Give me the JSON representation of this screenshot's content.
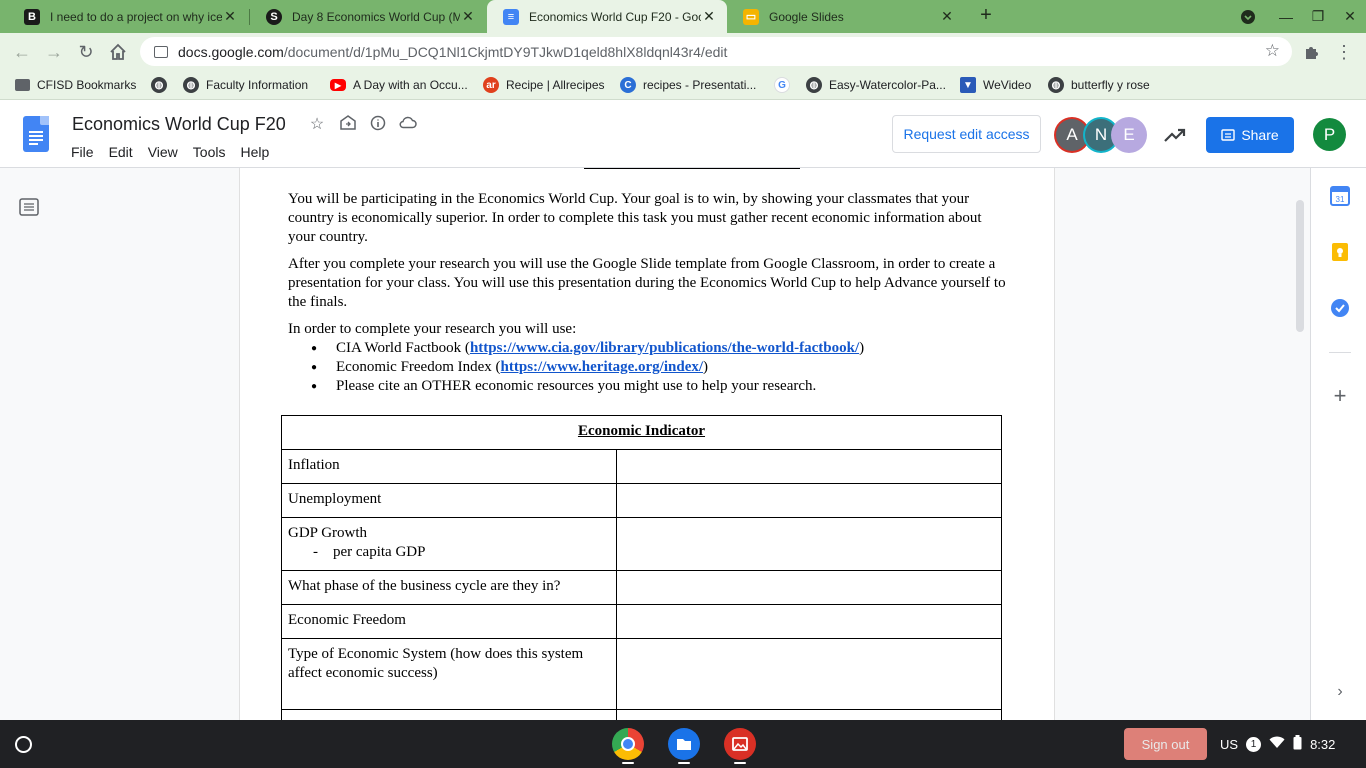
{
  "browser": {
    "tabs": [
      {
        "title": "I need to do a project on why ice",
        "favicon": "brainly-icon",
        "active": false
      },
      {
        "title": "Day 8 Economics World Cup (M",
        "favicon": "schoology-icon",
        "active": false
      },
      {
        "title": "Economics World Cup F20 - Goo",
        "favicon": "google-docs-icon",
        "active": true
      },
      {
        "title": "Google Slides",
        "favicon": "google-slides-icon",
        "active": false
      }
    ],
    "url_domain": "docs.google.com",
    "url_path": "/document/d/1pMu_DCQ1Nl1CkjmtDY9TJkwD1qeld8hlX8ldqnl43r4/edit",
    "bookmarks": [
      {
        "label": "CFISD Bookmarks",
        "icon": "folder-icon"
      },
      {
        "label": "",
        "icon": "globe-icon"
      },
      {
        "label": "Faculty Information",
        "icon": "globe-icon"
      },
      {
        "label": "A Day with an Occu...",
        "icon": "youtube-icon"
      },
      {
        "label": "Recipe | Allrecipes",
        "icon": "allrecipes-icon"
      },
      {
        "label": "recipes - Presentati...",
        "icon": "canva-icon"
      },
      {
        "label": "",
        "icon": "google-icon"
      },
      {
        "label": "Easy-Watercolor-Pa...",
        "icon": "globe-icon"
      },
      {
        "label": "WeVideo",
        "icon": "wevideo-icon"
      },
      {
        "label": "butterfly y rose",
        "icon": "globe-icon"
      }
    ]
  },
  "docs": {
    "title": "Economics World Cup F20",
    "menu": [
      "File",
      "Edit",
      "View",
      "Tools",
      "Help"
    ],
    "request_edit_label": "Request edit access",
    "share_label": "Share",
    "collaborators": [
      {
        "initial": "A",
        "color": "#5f6368",
        "ring": "#d93025"
      },
      {
        "initial": "N",
        "color": "#3c6f7a",
        "ring": "#12b5cb"
      },
      {
        "initial": "E",
        "color": "#b7a9e0",
        "ring": "#b7a9e0"
      }
    ],
    "profile_initial": "P"
  },
  "document": {
    "para1": "You will be participating in the Economics World Cup. Your goal is to win, by showing your classmates that your country is economically superior. In order to complete this task you must gather recent economic information about your country.",
    "para2": "After you complete your research you will use the Google Slide template from Google Classroom, in order to create a presentation for your class. You will use this presentation during the Economics World Cup to help Advance yourself to the finals.",
    "para3": "In order to complete your research you will use:",
    "bullets": [
      {
        "prefix": "CIA World Factbook (",
        "link": "https://www.cia.gov/library/publications/the-world-factbook/",
        "suffix": ")"
      },
      {
        "prefix": "Economic Freedom Index (",
        "link": "https://www.heritage.org/index/",
        "suffix": ")"
      },
      {
        "prefix": "Please cite an OTHER economic resources you might use to help your research.",
        "link": "",
        "suffix": ""
      }
    ],
    "table": {
      "header": "Economic Indicator",
      "rows": [
        {
          "label": "Inflation",
          "sub": ""
        },
        {
          "label": "Unemployment",
          "sub": ""
        },
        {
          "label": "GDP Growth",
          "sub": "per capita GDP"
        },
        {
          "label": "What phase of the business cycle are they in?",
          "sub": ""
        },
        {
          "label": "Economic Freedom",
          "sub": ""
        },
        {
          "label": "Type of Economic System (how does this system affect economic success)",
          "sub": ""
        }
      ]
    }
  },
  "shelf": {
    "signout_label": "Sign out",
    "locale": "US",
    "notification_count": "1",
    "time": "8:32"
  }
}
